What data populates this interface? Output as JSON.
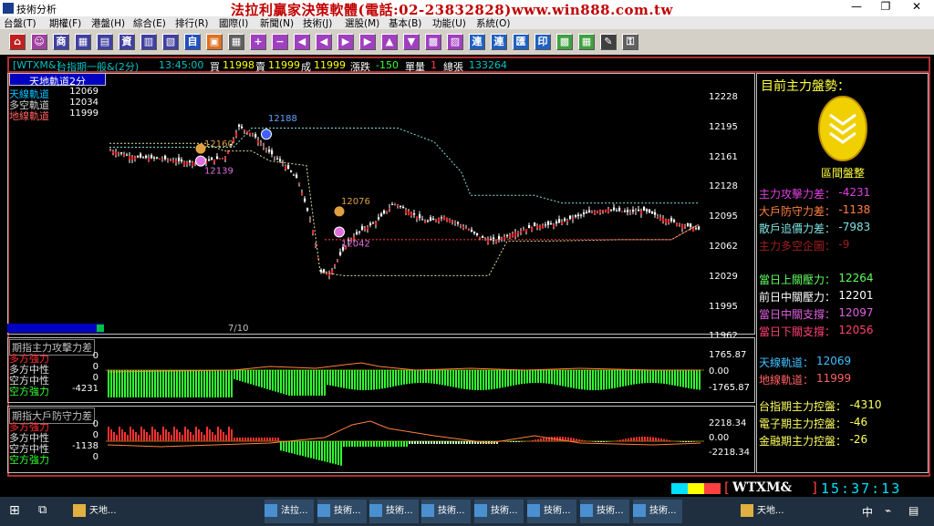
{
  "window": {
    "title": "技術分析",
    "ad_text": "法拉利贏家決策軟體(電話:02-23832828)www.win888.com.tw"
  },
  "menu": [
    "台盤(T)",
    "期權(F)",
    "港盤(H)",
    "綜合(E)",
    "排行(R)",
    "國際(I)",
    "新聞(N)",
    "技術(J)",
    "選股(M)",
    "基本(B)",
    "功能(U)",
    "系統(O)"
  ],
  "toolbar": {
    "buttons": [
      "⌂",
      "☺",
      "商",
      "▦",
      "▤",
      "資",
      "▥",
      "▧",
      "自",
      "▣",
      "▦",
      "+",
      "−",
      "◀",
      "◀",
      "▶",
      "▶",
      "▲",
      "▼",
      "▩",
      "▨",
      "連",
      "連",
      "匯",
      "印",
      "▩",
      "▦",
      "✎",
      "⚿"
    ]
  },
  "info": {
    "symbol": "[WTXM&]",
    "name": "台指期一般&(2分)",
    "time": "13:45:00",
    "bid_label": "買",
    "bid": "11998",
    "ask_label": "賣",
    "ask": "11999",
    "trade_label": "成",
    "trade": "11999",
    "change_label": "漲跌",
    "change": "-150",
    "vol_label": "單量",
    "vol": "1",
    "total_label": "總張",
    "total": "133264"
  },
  "main_chart": {
    "tab": "天地軌道2分",
    "legend": [
      {
        "label": "天線軌道",
        "value": "12069",
        "color": "#00c0ff"
      },
      {
        "label": "多空軌道",
        "value": "12034",
        "color": "#d0d0d0"
      },
      {
        "label": "地線軌道",
        "value": "11999",
        "color": "#ff6060"
      }
    ],
    "y_ticks": [
      "12228",
      "12195",
      "12161",
      "12128",
      "12095",
      "12062",
      "12029",
      "11995",
      "11962"
    ],
    "x_label": "7/10",
    "annotations": [
      {
        "text": "12188",
        "color": "#60a0ff"
      },
      {
        "text": "12160",
        "color": "#e0a040"
      },
      {
        "text": "12139",
        "color": "#e070e0"
      },
      {
        "text": "12076",
        "color": "#e0a040"
      },
      {
        "text": "12042",
        "color": "#e070e0"
      }
    ]
  },
  "sub1": {
    "title": "期指主力攻擊力差",
    "legend": [
      {
        "label": "多方強力",
        "value": "0",
        "color": "#ff3030"
      },
      {
        "label": "多方中性",
        "value": "0",
        "color": "#e0e0e0"
      },
      {
        "label": "空方中性",
        "value": "0",
        "color": "#e0e0e0"
      },
      {
        "label": "空方強力",
        "value": "-4231",
        "color": "#30ff30"
      }
    ],
    "y_ticks": [
      "1765.87",
      "0.00",
      "-1765.87"
    ]
  },
  "sub2": {
    "title": "期指大戶防守力差",
    "legend": [
      {
        "label": "多方強力",
        "value": "0",
        "color": "#ff3030"
      },
      {
        "label": "多方中性",
        "value": "0",
        "color": "#e0e0e0"
      },
      {
        "label": "空方中性",
        "value": "-1138",
        "color": "#e0e0e0"
      },
      {
        "label": "空方強力",
        "value": "0",
        "color": "#30ff30"
      }
    ],
    "y_ticks": [
      "2218.34",
      "0.00",
      "-2218.34"
    ]
  },
  "right_panel": {
    "title": "目前主力盤勢：",
    "badge_label": "區間盤整",
    "stats1": [
      {
        "label": "主力攻擊力差：",
        "value": "-4231",
        "color": "#e040e0"
      },
      {
        "label": "大戶防守力差：",
        "value": "-1138",
        "color": "#ff8040"
      },
      {
        "label": "散戶追價力差：",
        "value": "-7983",
        "color": "#80e0e0"
      },
      {
        "label": "主力多空企圖：",
        "value": "-9",
        "color": "#a02020"
      }
    ],
    "stats2": [
      {
        "label": "當日上關壓力：",
        "value": "12264",
        "color": "#60ff60"
      },
      {
        "label": "前日中關壓力：",
        "value": "12201",
        "color": "#ffffff"
      },
      {
        "label": "當日中關支撐：",
        "value": "12097",
        "color": "#e060e0"
      },
      {
        "label": "當日下關支撐：",
        "value": "12056",
        "color": "#ff4070"
      }
    ],
    "stats3": [
      {
        "label": "天線軌道：",
        "value": "12069",
        "color": "#40c0ff"
      },
      {
        "label": "地線軌道：",
        "value": "11999",
        "color": "#ff6060"
      }
    ],
    "stats4": [
      {
        "label": "台指期主力控盤：",
        "value": "-4310",
        "color": "#ffff60"
      },
      {
        "label": "電子期主力控盤：",
        "value": "-46",
        "color": "#ffff60"
      },
      {
        "label": "金融期主力控盤：",
        "value": "-26",
        "color": "#ffff60"
      }
    ]
  },
  "status": {
    "symbol": "WTXM&",
    "clock": "15:37:13"
  },
  "taskbar": {
    "apps": [
      "天地...",
      "法拉...",
      "技術...",
      "技術...",
      "技術...",
      "技術...",
      "技術...",
      "技術...",
      "技術...",
      "天地..."
    ],
    "ime": "中"
  }
}
